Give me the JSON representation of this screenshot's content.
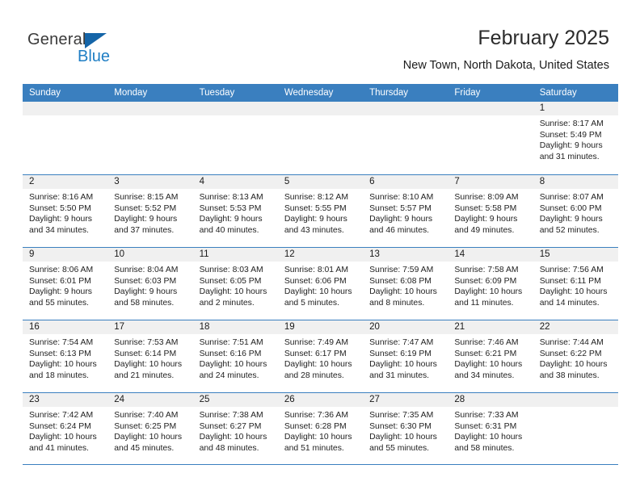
{
  "brand": {
    "name_part1": "General",
    "name_part2": "Blue",
    "logo_icon": "blue-triangle-logo"
  },
  "header": {
    "title": "February 2025",
    "subtitle": "New Town, North Dakota, United States"
  },
  "colors": {
    "header_blue": "#3a7fbf",
    "brand_blue": "#1f7ec4",
    "logo_blue": "#1565a8",
    "daybar_gray": "#f0f0f0",
    "text": "#222222"
  },
  "weekdays": [
    "Sunday",
    "Monday",
    "Tuesday",
    "Wednesday",
    "Thursday",
    "Friday",
    "Saturday"
  ],
  "labels": {
    "sunrise": "Sunrise:",
    "sunset": "Sunset:",
    "daylight": "Daylight:"
  },
  "weeks": [
    [
      {
        "day": "",
        "line1": "",
        "line2": "",
        "line3": "",
        "line4": ""
      },
      {
        "day": "",
        "line1": "",
        "line2": "",
        "line3": "",
        "line4": ""
      },
      {
        "day": "",
        "line1": "",
        "line2": "",
        "line3": "",
        "line4": ""
      },
      {
        "day": "",
        "line1": "",
        "line2": "",
        "line3": "",
        "line4": ""
      },
      {
        "day": "",
        "line1": "",
        "line2": "",
        "line3": "",
        "line4": ""
      },
      {
        "day": "",
        "line1": "",
        "line2": "",
        "line3": "",
        "line4": ""
      },
      {
        "day": "1",
        "line1": "Sunrise: 8:17 AM",
        "line2": "Sunset: 5:49 PM",
        "line3": "Daylight: 9 hours",
        "line4": "and 31 minutes."
      }
    ],
    [
      {
        "day": "2",
        "line1": "Sunrise: 8:16 AM",
        "line2": "Sunset: 5:50 PM",
        "line3": "Daylight: 9 hours",
        "line4": "and 34 minutes."
      },
      {
        "day": "3",
        "line1": "Sunrise: 8:15 AM",
        "line2": "Sunset: 5:52 PM",
        "line3": "Daylight: 9 hours",
        "line4": "and 37 minutes."
      },
      {
        "day": "4",
        "line1": "Sunrise: 8:13 AM",
        "line2": "Sunset: 5:53 PM",
        "line3": "Daylight: 9 hours",
        "line4": "and 40 minutes."
      },
      {
        "day": "5",
        "line1": "Sunrise: 8:12 AM",
        "line2": "Sunset: 5:55 PM",
        "line3": "Daylight: 9 hours",
        "line4": "and 43 minutes."
      },
      {
        "day": "6",
        "line1": "Sunrise: 8:10 AM",
        "line2": "Sunset: 5:57 PM",
        "line3": "Daylight: 9 hours",
        "line4": "and 46 minutes."
      },
      {
        "day": "7",
        "line1": "Sunrise: 8:09 AM",
        "line2": "Sunset: 5:58 PM",
        "line3": "Daylight: 9 hours",
        "line4": "and 49 minutes."
      },
      {
        "day": "8",
        "line1": "Sunrise: 8:07 AM",
        "line2": "Sunset: 6:00 PM",
        "line3": "Daylight: 9 hours",
        "line4": "and 52 minutes."
      }
    ],
    [
      {
        "day": "9",
        "line1": "Sunrise: 8:06 AM",
        "line2": "Sunset: 6:01 PM",
        "line3": "Daylight: 9 hours",
        "line4": "and 55 minutes."
      },
      {
        "day": "10",
        "line1": "Sunrise: 8:04 AM",
        "line2": "Sunset: 6:03 PM",
        "line3": "Daylight: 9 hours",
        "line4": "and 58 minutes."
      },
      {
        "day": "11",
        "line1": "Sunrise: 8:03 AM",
        "line2": "Sunset: 6:05 PM",
        "line3": "Daylight: 10 hours",
        "line4": "and 2 minutes."
      },
      {
        "day": "12",
        "line1": "Sunrise: 8:01 AM",
        "line2": "Sunset: 6:06 PM",
        "line3": "Daylight: 10 hours",
        "line4": "and 5 minutes."
      },
      {
        "day": "13",
        "line1": "Sunrise: 7:59 AM",
        "line2": "Sunset: 6:08 PM",
        "line3": "Daylight: 10 hours",
        "line4": "and 8 minutes."
      },
      {
        "day": "14",
        "line1": "Sunrise: 7:58 AM",
        "line2": "Sunset: 6:09 PM",
        "line3": "Daylight: 10 hours",
        "line4": "and 11 minutes."
      },
      {
        "day": "15",
        "line1": "Sunrise: 7:56 AM",
        "line2": "Sunset: 6:11 PM",
        "line3": "Daylight: 10 hours",
        "line4": "and 14 minutes."
      }
    ],
    [
      {
        "day": "16",
        "line1": "Sunrise: 7:54 AM",
        "line2": "Sunset: 6:13 PM",
        "line3": "Daylight: 10 hours",
        "line4": "and 18 minutes."
      },
      {
        "day": "17",
        "line1": "Sunrise: 7:53 AM",
        "line2": "Sunset: 6:14 PM",
        "line3": "Daylight: 10 hours",
        "line4": "and 21 minutes."
      },
      {
        "day": "18",
        "line1": "Sunrise: 7:51 AM",
        "line2": "Sunset: 6:16 PM",
        "line3": "Daylight: 10 hours",
        "line4": "and 24 minutes."
      },
      {
        "day": "19",
        "line1": "Sunrise: 7:49 AM",
        "line2": "Sunset: 6:17 PM",
        "line3": "Daylight: 10 hours",
        "line4": "and 28 minutes."
      },
      {
        "day": "20",
        "line1": "Sunrise: 7:47 AM",
        "line2": "Sunset: 6:19 PM",
        "line3": "Daylight: 10 hours",
        "line4": "and 31 minutes."
      },
      {
        "day": "21",
        "line1": "Sunrise: 7:46 AM",
        "line2": "Sunset: 6:21 PM",
        "line3": "Daylight: 10 hours",
        "line4": "and 34 minutes."
      },
      {
        "day": "22",
        "line1": "Sunrise: 7:44 AM",
        "line2": "Sunset: 6:22 PM",
        "line3": "Daylight: 10 hours",
        "line4": "and 38 minutes."
      }
    ],
    [
      {
        "day": "23",
        "line1": "Sunrise: 7:42 AM",
        "line2": "Sunset: 6:24 PM",
        "line3": "Daylight: 10 hours",
        "line4": "and 41 minutes."
      },
      {
        "day": "24",
        "line1": "Sunrise: 7:40 AM",
        "line2": "Sunset: 6:25 PM",
        "line3": "Daylight: 10 hours",
        "line4": "and 45 minutes."
      },
      {
        "day": "25",
        "line1": "Sunrise: 7:38 AM",
        "line2": "Sunset: 6:27 PM",
        "line3": "Daylight: 10 hours",
        "line4": "and 48 minutes."
      },
      {
        "day": "26",
        "line1": "Sunrise: 7:36 AM",
        "line2": "Sunset: 6:28 PM",
        "line3": "Daylight: 10 hours",
        "line4": "and 51 minutes."
      },
      {
        "day": "27",
        "line1": "Sunrise: 7:35 AM",
        "line2": "Sunset: 6:30 PM",
        "line3": "Daylight: 10 hours",
        "line4": "and 55 minutes."
      },
      {
        "day": "28",
        "line1": "Sunrise: 7:33 AM",
        "line2": "Sunset: 6:31 PM",
        "line3": "Daylight: 10 hours",
        "line4": "and 58 minutes."
      },
      {
        "day": "",
        "line1": "",
        "line2": "",
        "line3": "",
        "line4": ""
      }
    ]
  ]
}
